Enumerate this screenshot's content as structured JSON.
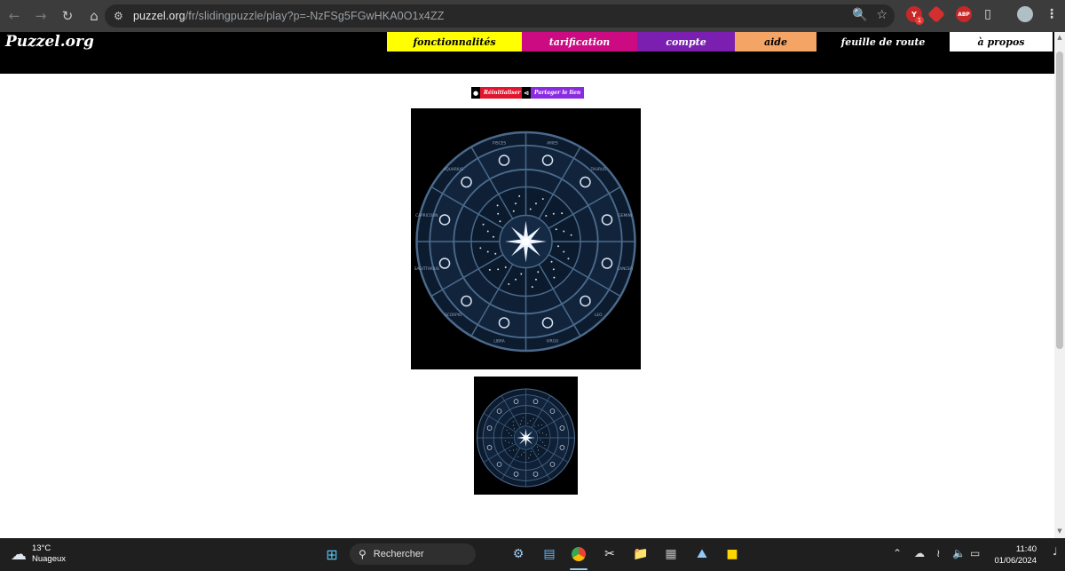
{
  "browser": {
    "url_domain": "puzzel.org",
    "url_path": "/fr/slidingpuzzle/play?p=-NzFSg5FGwHKA0O1x4ZZ",
    "icons": [
      "back-icon",
      "forward-icon",
      "reload-icon",
      "home-icon",
      "site-info-icon",
      "zoom-icon",
      "bookmark-star-icon",
      "extensions-icon",
      "profile-avatar",
      "menu-icon"
    ],
    "ext_badge": "1",
    "abp_label": "ABP"
  },
  "site": {
    "logo": "Puzzel.org",
    "menu": [
      {
        "label": "fonctionnalités",
        "bg": "#ffff00",
        "fg": "#000000"
      },
      {
        "label": "tarification",
        "bg": "#cc0a82",
        "fg": "#ffffff"
      },
      {
        "label": "compte",
        "bg": "#7a1fb0",
        "fg": "#ffffff"
      },
      {
        "label": "aide",
        "bg": "#f4a566",
        "fg": "#000000"
      },
      {
        "label": "feuille de route",
        "bg": "#000000",
        "fg": "#ffffff"
      },
      {
        "label": "à propos",
        "bg": "#ffffff",
        "fg": "#000000"
      }
    ]
  },
  "toolbar": {
    "reset_label": "Réinitialiser",
    "reset_color": "#e2152e",
    "share_label": "Partager le lien",
    "share_color": "#8a2be2"
  },
  "puzzle": {
    "zodiac_labels": [
      "ARIES",
      "TAURUS",
      "GEMINI",
      "CANCER",
      "LEO",
      "VIRGO",
      "LIBRA",
      "SCORPIO",
      "SAGITTARIUS",
      "CAPRICORN",
      "AQUARIUS",
      "PISCES"
    ],
    "ring_color": "#4a6a8c"
  },
  "taskbar": {
    "temperature": "13°C",
    "weather": "Nuageux",
    "search_placeholder": "Rechercher",
    "time": "11:40",
    "date": "01/06/2024"
  }
}
